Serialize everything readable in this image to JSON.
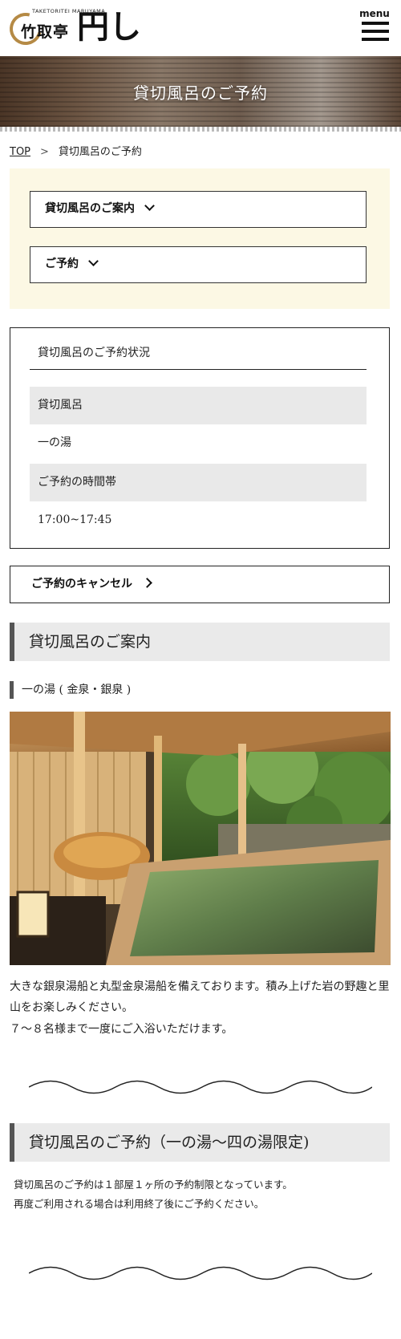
{
  "header": {
    "logo_small": "TAKETORITEI  MARUYAMA",
    "logo_text": "竹取亭",
    "logo_brush": "円し",
    "menu_label": "menu"
  },
  "hero": {
    "title": "貸切風呂のご予約"
  },
  "breadcrumb": {
    "top": "TOP",
    "separator": ">",
    "current": "貸切風呂のご予約"
  },
  "nav": {
    "guide_label": "貸切風呂のご案内",
    "reserve_label": "ご予約"
  },
  "status": {
    "title": "貸切風呂のご予約状況",
    "rows": [
      {
        "label": "貸切風呂",
        "value": "一の湯"
      },
      {
        "label": "ご予約の時間帯",
        "value": "17:00~17:45"
      }
    ]
  },
  "cancel": {
    "label": "ご予約のキャンセル"
  },
  "guide": {
    "heading": "貸切風呂のご案内",
    "sub_heading": "一の湯 ( 金泉・銀泉 )",
    "text_1": "大きな銀泉湯船と丸型金泉湯船を備えております。積み上げた岩の野趣と里山をお楽しみください。",
    "text_2": "７～８名様まで一度にご入浴いただけます。"
  },
  "booking": {
    "heading": "貸切風呂のご予約（一の湯～四の湯限定)",
    "text_1": "貸切風呂のご予約は１部屋１ヶ所の予約制限となっています。",
    "text_2": "再度ご利用される場合は利用終了後にご予約ください。"
  },
  "colors": {
    "nav_background": "#fcf8e4",
    "heading_background": "#eaeaea",
    "heading_accent": "#555555",
    "logo_gold": "#b58a45"
  }
}
